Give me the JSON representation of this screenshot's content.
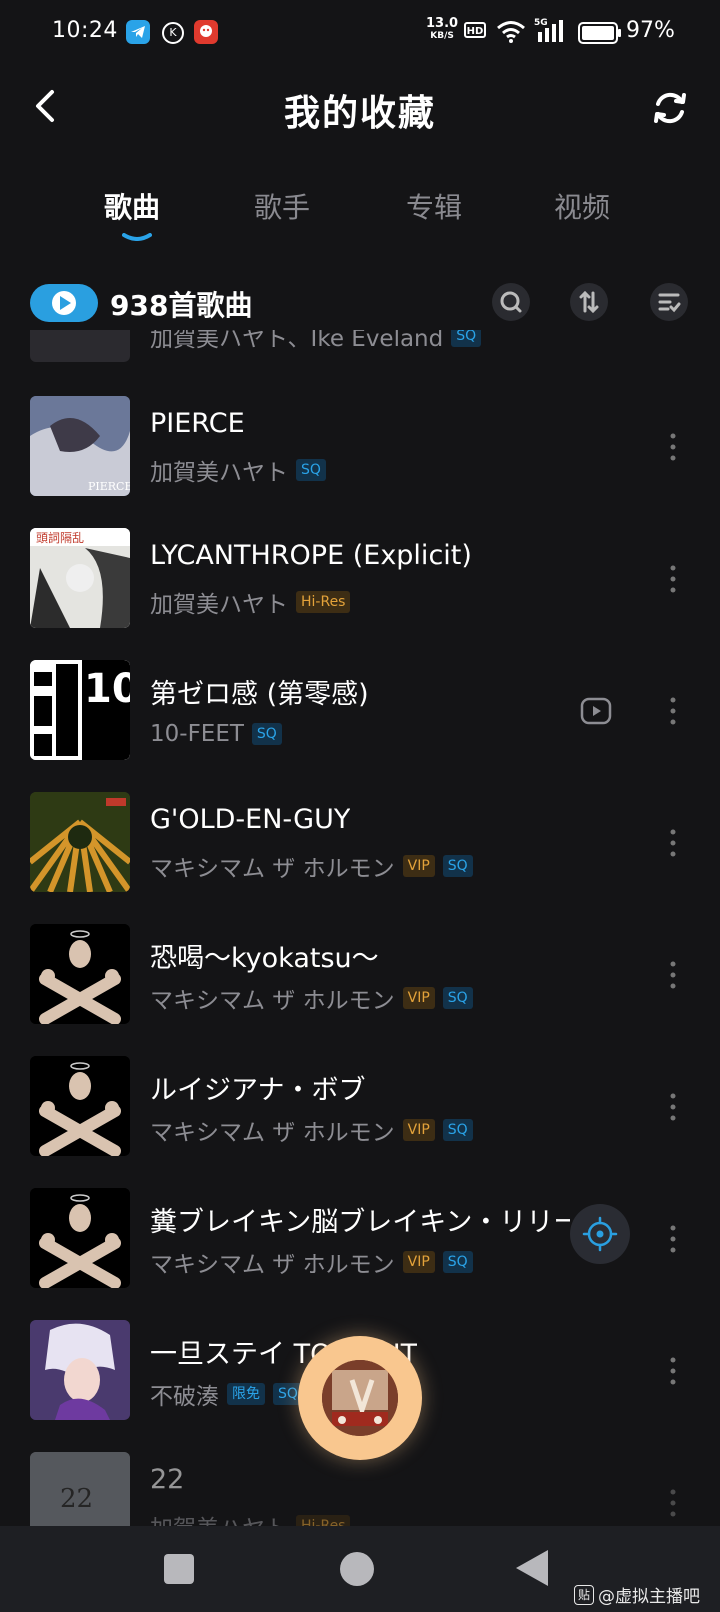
{
  "status_bar": {
    "time": "10:24",
    "net_speed_value": "13.0",
    "net_speed_unit": "KB/S",
    "hd_label": "HD",
    "network_type": "5G",
    "battery_percent": "97%",
    "apps": [
      {
        "icon": "telegram-icon",
        "color": "#2aa3e8"
      },
      {
        "icon": "k-icon",
        "color": "#ffffff"
      },
      {
        "icon": "app-red-icon",
        "color": "#e03a2e"
      }
    ]
  },
  "header": {
    "title": "我的收藏",
    "back_icon": "back-arrow-icon",
    "refresh_icon": "refresh-icon"
  },
  "tabs": [
    {
      "label": "歌曲",
      "active": true
    },
    {
      "label": "歌手",
      "active": false
    },
    {
      "label": "专辑",
      "active": false
    },
    {
      "label": "视频",
      "active": false
    }
  ],
  "list_header": {
    "count_label": "938首歌曲",
    "actions": [
      "search-icon",
      "sort-icon",
      "multi-select-icon"
    ]
  },
  "partial_row": {
    "artist": "加賀美ハヤト、Ike Eveland",
    "badge": "SQ"
  },
  "songs": [
    {
      "title": "PIERCE",
      "artist": "加賀美ハヤト",
      "badges": [
        {
          "text": "SQ",
          "kind": "sq"
        }
      ],
      "cover_text": "PIERCE",
      "has_mv": false,
      "cover_color": "#5b6a8f"
    },
    {
      "title": "LYCANTHROPE (Explicit)",
      "artist": "加賀美ハヤト",
      "badges": [
        {
          "text": "Hi-Res",
          "kind": "hires"
        }
      ],
      "cover_text": "",
      "has_mv": false,
      "cover_color": "#d8d8d4"
    },
    {
      "title": "第ゼロ感 (第零感)",
      "artist": "10-FEET",
      "badges": [
        {
          "text": "SQ",
          "kind": "sq"
        }
      ],
      "cover_text": "10",
      "has_mv": true,
      "cover_color": "#000000"
    },
    {
      "title": "G'OLD-EN-GUY",
      "artist": "マキシマム ザ ホルモン",
      "badges": [
        {
          "text": "VIP",
          "kind": "vip"
        },
        {
          "text": "SQ",
          "kind": "sq"
        }
      ],
      "cover_text": "",
      "has_mv": false,
      "cover_color": "#3a4a1a"
    },
    {
      "title": "恐喝～kyokatsu～",
      "artist": "マキシマム ザ ホルモン",
      "badges": [
        {
          "text": "VIP",
          "kind": "vip"
        },
        {
          "text": "SQ",
          "kind": "sq"
        }
      ],
      "cover_text": "",
      "has_mv": false,
      "cover_color": "#000000"
    },
    {
      "title": "ルイジアナ・ボブ",
      "artist": "マキシマム ザ ホルモン",
      "badges": [
        {
          "text": "VIP",
          "kind": "vip"
        },
        {
          "text": "SQ",
          "kind": "sq"
        }
      ],
      "cover_text": "",
      "has_mv": false,
      "cover_color": "#000000"
    },
    {
      "title": "糞ブレイキン脳ブレイキン・リリー",
      "artist": "マキシマム ザ ホルモン",
      "badges": [
        {
          "text": "VIP",
          "kind": "vip"
        },
        {
          "text": "SQ",
          "kind": "sq"
        }
      ],
      "cover_text": "",
      "has_mv": false,
      "cover_color": "#000000"
    },
    {
      "title": "一旦ステイ TONIGHT",
      "artist": "不破湊",
      "badges": [
        {
          "text": "限免",
          "kind": "free"
        },
        {
          "text": "SQ",
          "kind": "sq"
        }
      ],
      "cover_text": "",
      "has_mv": false,
      "cover_color": "#3a2a5a"
    },
    {
      "title": "22",
      "artist": "加賀美ハヤト",
      "badges": [
        {
          "text": "Hi-Res",
          "kind": "hires"
        }
      ],
      "cover_text": "22",
      "has_mv": false,
      "cover_color": "#7a8088"
    }
  ],
  "floating": {
    "locate_icon": "locate-crosshair-icon",
    "player_icon": "now-playing-disc-icon",
    "player_color": "#f9c78f"
  },
  "nav_bar": {
    "buttons": [
      "recent-apps-square-icon",
      "home-circle-icon",
      "back-triangle-icon"
    ]
  },
  "watermark": {
    "box_text": "贴",
    "text": "@虚拟主播吧"
  }
}
